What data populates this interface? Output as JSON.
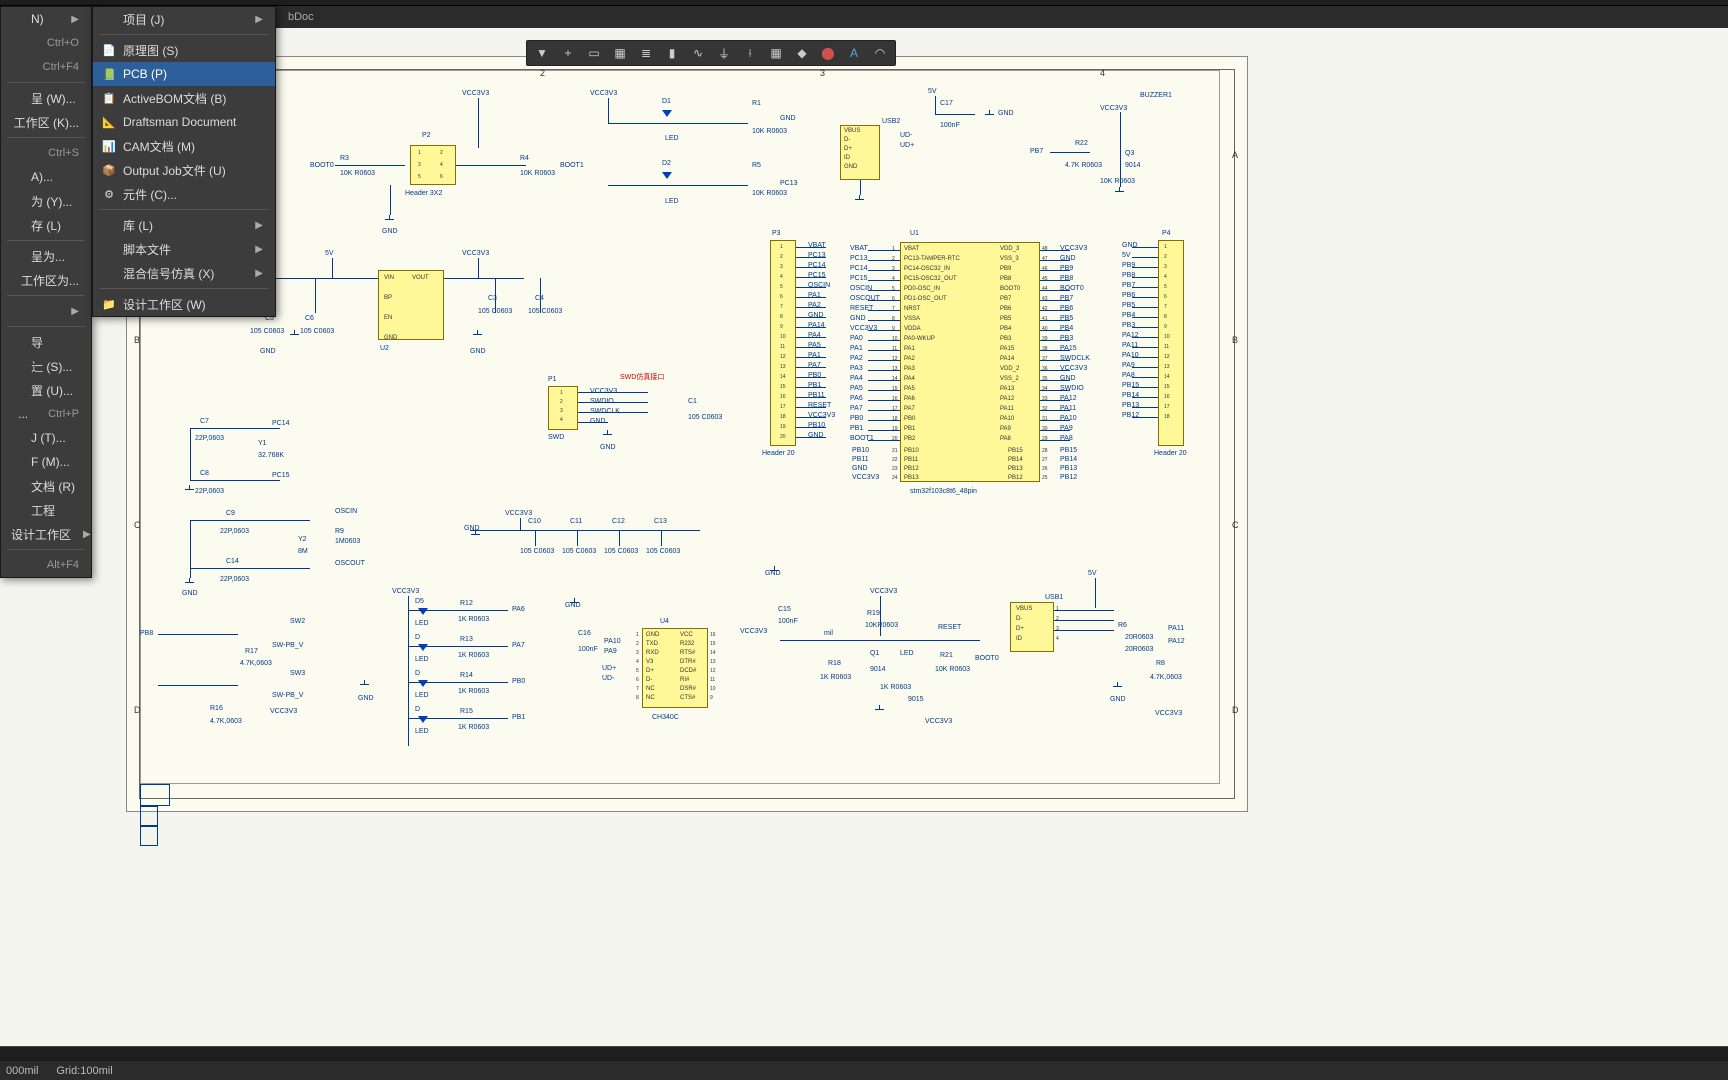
{
  "tab": {
    "name": "bDoc"
  },
  "menu1": {
    "items": [
      {
        "label": "N)",
        "arrow": true
      },
      {
        "label": "",
        "accel": "Ctrl+O"
      },
      {
        "label": "",
        "accel": "Ctrl+F4"
      },
      {
        "sep": true
      },
      {
        "label": "呈 (W)..."
      },
      {
        "label": "工作区 (K)..."
      },
      {
        "sep": true
      },
      {
        "label": "",
        "accel": "Ctrl+S"
      },
      {
        "label": "A)..."
      },
      {
        "label": "为 (Y)..."
      },
      {
        "label": "存 (L)"
      },
      {
        "sep": true
      },
      {
        "label": "呈为..."
      },
      {
        "label": "工作区为..."
      },
      {
        "sep": true
      },
      {
        "label": "",
        "arrow": true
      },
      {
        "sep": true
      },
      {
        "label": "导"
      },
      {
        "label": "辷 (S)..."
      },
      {
        "label": "置 (U)..."
      },
      {
        "label": "...",
        "accel": "Ctrl+P"
      },
      {
        "label": "J (T)..."
      },
      {
        "label": "F (M)..."
      },
      {
        "label": "文档 (R)"
      },
      {
        "label": "工程"
      },
      {
        "label": "设计工作区",
        "arrow": true
      },
      {
        "sep": true
      },
      {
        "label": "",
        "accel": "Alt+F4"
      }
    ]
  },
  "menu2": {
    "items": [
      {
        "label": "项目 (J)",
        "icon": "",
        "arrow": true
      },
      {
        "sep": true
      },
      {
        "label": "原理图 (S)",
        "icon": "📄"
      },
      {
        "label": "PCB (P)",
        "icon": "📗",
        "hover": true
      },
      {
        "label": "ActiveBOM文档 (B)",
        "icon": "📋"
      },
      {
        "label": "Draftsman Document",
        "icon": "📐"
      },
      {
        "label": "CAM文档 (M)",
        "icon": "📊"
      },
      {
        "label": "Output Job文件 (U)",
        "icon": "📦"
      },
      {
        "label": "元件 (C)...",
        "icon": "⚙"
      },
      {
        "sep": true
      },
      {
        "label": "库 (L)",
        "arrow": true
      },
      {
        "label": "脚本文件",
        "arrow": true
      },
      {
        "label": "混合信号仿真 (X)",
        "arrow": true
      },
      {
        "sep": true
      },
      {
        "label": "设计工作区 (W)",
        "icon": "📁"
      }
    ]
  },
  "toolbar": {
    "buttons": [
      "filter",
      "plus",
      "rect",
      "group",
      "align",
      "vline",
      "wave",
      "gnd",
      "dim",
      "chip",
      "tag",
      "net",
      "text",
      "arc"
    ]
  },
  "status": {
    "left": "000mil",
    "grid": "Grid:100mil"
  },
  "sch": {
    "ruler_top": [
      "2",
      "3",
      "4"
    ],
    "side_letters": [
      "A",
      "B",
      "C",
      "D"
    ],
    "boot": {
      "r3": "R3",
      "r3v": "10K R0603",
      "r4": "R4",
      "r4v": "10K R0603",
      "b0": "BOOT0",
      "b1": "BOOT1",
      "p2": "P2",
      "p2v": "Header 3X2",
      "gnd": "GND",
      "vcc": "VCC3V3"
    },
    "leds_top": {
      "d1": "D1",
      "d2": "D2",
      "r1": "R1",
      "r2": "R5",
      "r1v": "10K R0603",
      "r2v": "10K R0603",
      "gnd": "GND",
      "led": "LED",
      "pc13": "PC13",
      "vcc": "VCC3V3"
    },
    "usb2": {
      "name": "USB2",
      "c17": "C17",
      "c17v": "100nF",
      "v5": "5V",
      "gnd": "GND",
      "vbus": "VBUS",
      "dm": "D-",
      "dp": "D+",
      "id": "ID",
      "sgnd": "GND",
      "udm": "UD-",
      "udp": "UD+"
    },
    "buzzer": {
      "name": "BUZZER1",
      "vcc": "VCC3V3",
      "q3": "Q3",
      "q3v": "9014",
      "r22": "R22",
      "r22v": "4.7K R0603",
      "r23v": "10K R0603",
      "pb7": "PB7",
      "gnd": "GND"
    },
    "ldo": {
      "vin": "VIN",
      "vout": "VOUT",
      "en": "EN",
      "bp": "BP",
      "gnd": "GND",
      "u2": "U2",
      "c5": "C5",
      "c5v": "105 C0603",
      "c6": "C6",
      "c6v": "105 C0603",
      "c3": "C3",
      "c3v": "105 C0603",
      "c4": "C4",
      "c4v": "105 C0603",
      "v5": "5V",
      "v33": "VCC3V3",
      "gnd2": "GND"
    },
    "swd": {
      "title": "SWD仿真接口",
      "p1": "P1",
      "c1": "C1",
      "c1v": "105 C0603",
      "swd": "SWD",
      "vcc": "VCC3V3",
      "swdio": "SWDIO",
      "swdclk": "SWDCLK",
      "gnd": "GND"
    },
    "p3": {
      "name": "P3",
      "type": "Header 20",
      "pins": [
        "VBAT",
        "PC13",
        "PC14",
        "PC15",
        "OSCIN",
        "PA1",
        "PA2",
        "GND",
        "PA14",
        "PA4",
        "PA5",
        "PA1",
        "PA7",
        "PB0",
        "PB1",
        "PB11",
        "RESET",
        "VCC3V3",
        "PB10",
        "GND"
      ]
    },
    "p4": {
      "name": "P4",
      "type": "Header 20",
      "pins": [
        "GND",
        "5V",
        "PB9",
        "PB8",
        "PB7",
        "PB6",
        "PB5",
        "PB4",
        "PB3",
        "PA12",
        "PA11",
        "PA10",
        "PA9",
        "PA8",
        "PB15",
        "PB14",
        "PB13",
        "PB12",
        "",
        ""
      ]
    },
    "u1": {
      "name": "U1",
      "part": "stm32f103c8t6_48pin",
      "left_sig": [
        "VBAT",
        "PC13",
        "PC14",
        "PC15",
        "OSCIN",
        "OSCOUT",
        "RESET",
        "GND",
        "VCC3V3",
        "PA0",
        "PA1",
        "PA2",
        "PA3",
        "PA4",
        "PA5",
        "PA6",
        "PA7",
        "PB0",
        "PB1",
        "BOOT1"
      ],
      "left_pin": [
        "VBAT",
        "PC13-TAMPER-RTC",
        "PC14-OSC32_IN",
        "PC15-OSC32_OUT",
        "PD0-OSC_IN",
        "PD1-OSC_OUT",
        "NRST",
        "VSSA",
        "VDDA",
        "PA0-WKUP",
        "PA1",
        "PA2",
        "PA3",
        "PA4",
        "PA5",
        "PA6",
        "PA7",
        "PB0",
        "PB1",
        "PB2"
      ],
      "right_pin": [
        "VDD_3",
        "VSS_3",
        "PB9",
        "PB8",
        "BOOT0",
        "PB7",
        "PB6",
        "PB5",
        "PB4",
        "PB3",
        "PA15",
        "PA14",
        "VDD_2",
        "VSS_2",
        "PA13",
        "PA12",
        "PA11",
        "PA10",
        "PA9",
        "PA8"
      ],
      "right_sig": [
        "VCC3V3",
        "GND",
        "PB9",
        "PB8",
        "BOOT0",
        "PB7",
        "PB6",
        "PB5",
        "PB4",
        "PB3",
        "PA15",
        "SWDCLK",
        "VCC3V3",
        "GND",
        "SWDIO",
        "PA12",
        "PA11",
        "PA10",
        "PA9",
        "PA8"
      ],
      "right_num": [
        "48",
        "47",
        "46",
        "45",
        "44",
        "43",
        "42",
        "41",
        "40",
        "39",
        "38",
        "37",
        "36",
        "35",
        "34",
        "33",
        "32",
        "31",
        "30",
        "29"
      ],
      "bot_left": [
        "PB10",
        "PB11",
        "GND",
        "VCC3V3"
      ],
      "bot_left_num": [
        "21",
        "22",
        "23",
        "24"
      ],
      "bot_right": [
        "PB15",
        "PB14",
        "PB13",
        "PB12"
      ],
      "bot_right_num": [
        "28",
        "27",
        "26",
        "25"
      ]
    },
    "xtal": {
      "c7": "C7",
      "c7v": "22P,0603",
      "c8": "C8",
      "c8v": "22P,0603",
      "y1": "Y1",
      "y1v": "32.768K",
      "pc14": "PC14",
      "pc15": "PC15",
      "gnd": "GND",
      "c9": "C9",
      "c9v": "22P,0603",
      "c14": "C14",
      "c14v": "22P,0603",
      "y2": "Y2",
      "y2v": "8M",
      "r9": "R9",
      "r9v": "1M0603",
      "oscin": "OSCIN",
      "oscout": "OSCOUT"
    },
    "caps_row": {
      "v33": "VCC3V3",
      "gnd": "GND",
      "c": [
        "C10",
        "C11",
        "C12",
        "C13"
      ],
      "cv": "105 C0603"
    },
    "sw": {
      "sw2": "SW2",
      "sw3": "SW3",
      "swv": "SW-PB_V",
      "pb8": "PB8",
      "r17": "R17",
      "r17v": "4.7K,0603",
      "r16": "R16",
      "r16v": "4.7K,0603",
      "gnd": "GND",
      "v33": "VCC3V3"
    },
    "leds4": {
      "d": [
        "D5",
        "D",
        "D",
        "D"
      ],
      "r": [
        "R12",
        "R13",
        "R14",
        "R15"
      ],
      "rv": "1K R0603",
      "net": [
        "PA6",
        "PA7",
        "PB0",
        "PB1"
      ],
      "v33": "VCC3V3",
      "led": "LED"
    },
    "ch340": {
      "u4": "U4",
      "part": "CH340C",
      "c16": "C16",
      "c16v": "100nF",
      "gnd": "GND",
      "vcc": "VCC",
      "v33": "VCC3V3",
      "pa10": "PA10",
      "pa9": "PA9",
      "udp": "UD+",
      "udm": "UD-",
      "txd": "TXD",
      "rxd": "RXD",
      "r232": "R232",
      "rts": "RTS#",
      "v3": "V3",
      "dtr": "DTR#",
      "dcd": "DCD#",
      "ri": "RI#",
      "dsr": "DSR#",
      "nc": "NC",
      "cts": "CTS#",
      "pins_r": [
        "16",
        "15",
        "14",
        "13",
        "12",
        "11",
        "10",
        "9"
      ]
    },
    "reset_ckt": {
      "c15": "C15",
      "c15v": "100nF",
      "r19": "R19",
      "r19v": "10KR0603",
      "r18": "R18",
      "r18v": "1K R0603",
      "q1": "Q1",
      "q1v": "9014",
      "r21": "R21",
      "r21v": "10K R0603",
      "r1b": "1K R0603",
      "reset": "RESET",
      "boot0": "BOOT0",
      "led": "LED",
      "mil": "mil",
      "v33": "VCC3V3",
      "gnd": "GND",
      "q2v": "9015"
    },
    "usb1": {
      "name": "USB1",
      "v5": "5V",
      "vbus": "VBUS",
      "dm": "D-",
      "dp": "D+",
      "id": "ID",
      "r6": "R6",
      "r6v": "20R0603",
      "r7v": "20R0603",
      "r8": "R8",
      "r8v": "4.7K,0603",
      "pa11": "PA11",
      "pa12": "PA12",
      "gnd": "GND",
      "v33": "VCC3V3"
    }
  }
}
